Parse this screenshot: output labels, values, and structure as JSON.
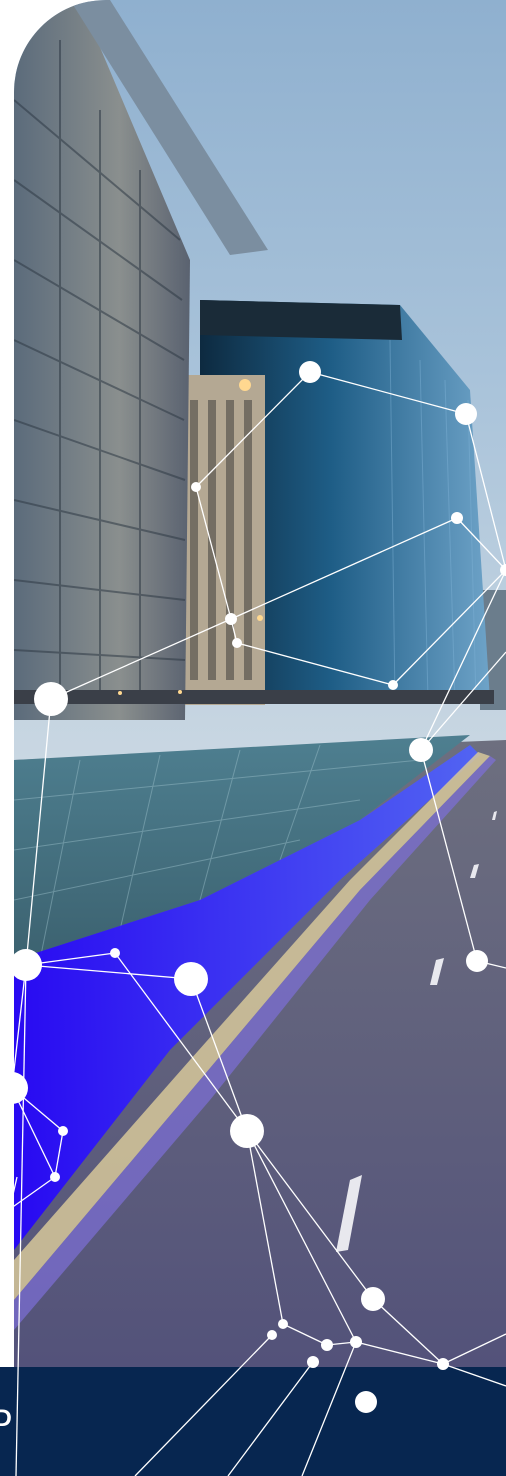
{
  "hero": {
    "image": "city-highway-office-buildings-dusk"
  },
  "footer": {
    "label": "ED"
  },
  "colors": {
    "footer_bg": "#072650",
    "overlay": "#ffffff",
    "road_glow": "#3a1cff"
  },
  "network": {
    "nodes": [
      [
        310,
        372,
        11
      ],
      [
        466,
        414,
        11
      ],
      [
        196,
        487,
        5
      ],
      [
        457,
        518,
        6
      ],
      [
        506,
        570,
        6
      ],
      [
        231,
        619,
        6
      ],
      [
        237,
        643,
        5
      ],
      [
        393,
        685,
        5
      ],
      [
        51,
        699,
        17
      ],
      [
        421,
        750,
        12
      ],
      [
        115,
        953,
        5
      ],
      [
        26,
        965,
        16
      ],
      [
        191,
        979,
        17
      ],
      [
        477,
        961,
        11
      ],
      [
        12,
        1088,
        16
      ],
      [
        247,
        1131,
        17
      ],
      [
        63,
        1131,
        5
      ],
      [
        55,
        1177,
        5
      ],
      [
        373,
        1299,
        12
      ],
      [
        283,
        1324,
        5
      ],
      [
        272,
        1335,
        5
      ],
      [
        327,
        1345,
        6
      ],
      [
        356,
        1342,
        6
      ],
      [
        313,
        1362,
        6
      ],
      [
        443,
        1364,
        6
      ],
      [
        366,
        1402,
        11
      ]
    ],
    "links": [
      [
        0,
        1
      ],
      [
        0,
        2
      ],
      [
        1,
        4
      ],
      [
        2,
        5
      ],
      [
        5,
        3
      ],
      [
        3,
        4
      ],
      [
        4,
        7
      ],
      [
        5,
        6
      ],
      [
        6,
        7
      ],
      [
        5,
        8
      ],
      [
        8,
        11
      ],
      [
        11,
        10
      ],
      [
        11,
        12
      ],
      [
        10,
        15
      ],
      [
        12,
        15
      ],
      [
        11,
        14
      ],
      [
        14,
        16
      ],
      [
        16,
        17
      ],
      [
        15,
        19
      ],
      [
        15,
        22
      ],
      [
        15,
        18
      ],
      [
        18,
        24
      ],
      [
        19,
        21
      ],
      [
        21,
        22
      ],
      [
        22,
        24
      ],
      [
        9,
        13
      ],
      [
        9,
        4
      ],
      [
        14,
        17
      ]
    ],
    "outgoing": [
      [
        272,
        1335,
        135,
        1476
      ],
      [
        313,
        1362,
        228,
        1476
      ],
      [
        356,
        1342,
        302,
        1476
      ],
      [
        443,
        1364,
        506,
        1334
      ],
      [
        443,
        1364,
        506,
        1386
      ],
      [
        17,
        1177,
        0,
        1252
      ],
      [
        55,
        1177,
        0,
        1216
      ],
      [
        477,
        961,
        506,
        968
      ],
      [
        421,
        750,
        506,
        652
      ],
      [
        26,
        965,
        16,
        1476
      ]
    ]
  }
}
